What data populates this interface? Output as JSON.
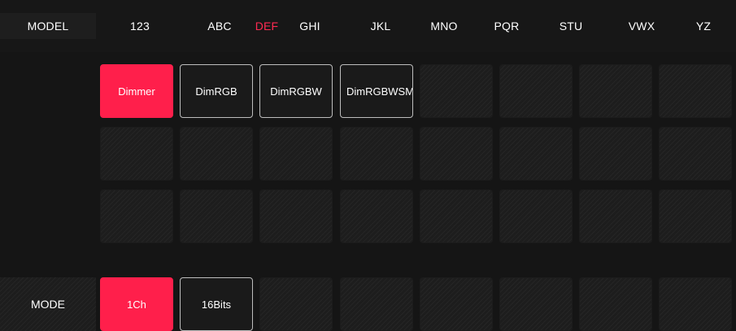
{
  "colors": {
    "accent": "#ff1f4b",
    "background": "#151515",
    "cell_border": "#bdbdbd"
  },
  "model_label": "MODEL",
  "tabs": [
    "123",
    "ABC",
    "DEF",
    "GHI",
    "JKL",
    "MNO",
    "PQR",
    "STU",
    "VWX",
    "YZ"
  ],
  "active_tab": "DEF",
  "models": [
    "Dimmer",
    "DimRGB",
    "DimRGBW",
    "DimRGBWSM"
  ],
  "selected_model": "Dimmer",
  "mode_label": "MODE",
  "modes": [
    "1Ch",
    "16Bits"
  ],
  "selected_mode": "1Ch"
}
